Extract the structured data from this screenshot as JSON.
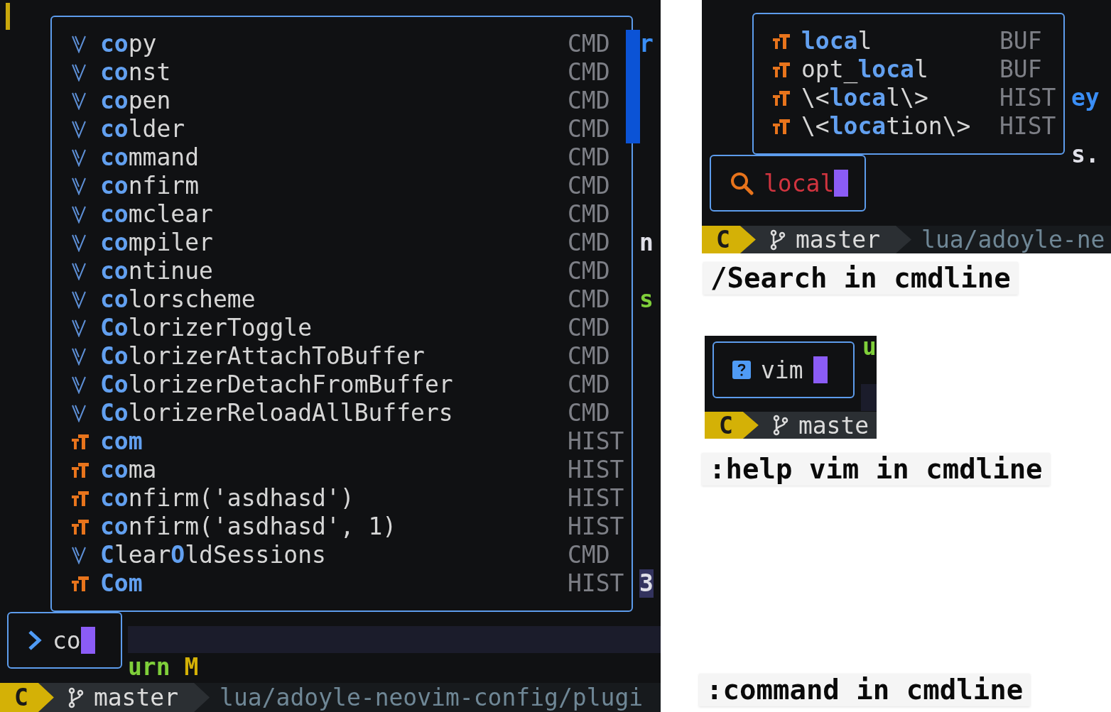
{
  "completion_screen": {
    "menu": {
      "items": [
        {
          "kind": "cmd",
          "text": "**co**py",
          "source": "CMD"
        },
        {
          "kind": "cmd",
          "text": "**co**nst",
          "source": "CMD"
        },
        {
          "kind": "cmd",
          "text": "**co**pen",
          "source": "CMD"
        },
        {
          "kind": "cmd",
          "text": "**co**lder",
          "source": "CMD"
        },
        {
          "kind": "cmd",
          "text": "**co**mmand",
          "source": "CMD"
        },
        {
          "kind": "cmd",
          "text": "**co**nfirm",
          "source": "CMD"
        },
        {
          "kind": "cmd",
          "text": "**co**mclear",
          "source": "CMD"
        },
        {
          "kind": "cmd",
          "text": "**co**mpiler",
          "source": "CMD"
        },
        {
          "kind": "cmd",
          "text": "**co**ntinue",
          "source": "CMD"
        },
        {
          "kind": "cmd",
          "text": "**co**lorscheme",
          "source": "CMD"
        },
        {
          "kind": "cmd",
          "text": "**Co**lorizerToggle",
          "source": "CMD"
        },
        {
          "kind": "cmd",
          "text": "**Co**lorizerAttachToBuffer",
          "source": "CMD"
        },
        {
          "kind": "cmd",
          "text": "**Co**lorizerDetachFromBuffer",
          "source": "CMD"
        },
        {
          "kind": "cmd",
          "text": "**Co**lorizerReloadAllBuffers",
          "source": "CMD"
        },
        {
          "kind": "hist",
          "text": "**com**",
          "source": "HIST"
        },
        {
          "kind": "hist",
          "text": "**co**ma",
          "source": "HIST"
        },
        {
          "kind": "hist",
          "text": "**co**nfirm('asdhasd')",
          "source": "HIST"
        },
        {
          "kind": "hist",
          "text": "**co**nfirm('asdhasd', 1)",
          "source": "HIST"
        },
        {
          "kind": "cmd",
          "text": "**C**lear**O**ldSessions",
          "source": "CMD"
        },
        {
          "kind": "hist",
          "text": "**Com**",
          "source": "HIST"
        }
      ]
    },
    "side_fragments": [
      {
        "text": "r",
        "kind": "keyword",
        "highlighted": false
      },
      {
        "text": "n",
        "kind": "plain",
        "highlighted": false
      },
      {
        "text": "s",
        "kind": "string",
        "highlighted": false
      },
      {
        "text": "3",
        "kind": "plain",
        "highlighted": true
      }
    ],
    "cmdline": {
      "kind": "command",
      "value": "co"
    },
    "below_fragments": [
      {
        "text": "urn",
        "kind": "string",
        "highlighted": false
      },
      {
        "text": "M",
        "kind": "constant",
        "highlighted": false
      }
    ],
    "statusline": {
      "mode": "C",
      "branch": "master",
      "path": "lua/adoyle-neovim-config/plugi"
    },
    "caption": ":command in cmdline"
  },
  "search_screen": {
    "menu": {
      "items": [
        {
          "kind": "hist",
          "text": "**loca**l",
          "source": "BUF"
        },
        {
          "kind": "hist",
          "text": "opt_**loca**l",
          "source": "BUF"
        },
        {
          "kind": "hist",
          "text": "\\<**loca**l\\>",
          "source": "HIST"
        },
        {
          "kind": "hist",
          "text": "\\<**loca**tion\\>",
          "source": "HIST"
        }
      ]
    },
    "side_fragments": [
      {
        "text": "ey",
        "kind": "keyword",
        "highlighted": false
      },
      {
        "text": "s.",
        "kind": "plain",
        "highlighted": false
      }
    ],
    "cmdline": {
      "kind": "search",
      "value": "local"
    },
    "statusline": {
      "mode": "C",
      "branch": "master",
      "path": "lua/adoyle-ne"
    },
    "caption": "/Search in cmdline"
  },
  "help_screen": {
    "side_fragments": [
      {
        "text": "u",
        "kind": "string",
        "highlighted": false
      }
    ],
    "cmdline": {
      "kind": "help",
      "value": "vim"
    },
    "statusline": {
      "mode": "C",
      "branch": "maste"
    },
    "caption": ":help vim in cmdline"
  }
}
